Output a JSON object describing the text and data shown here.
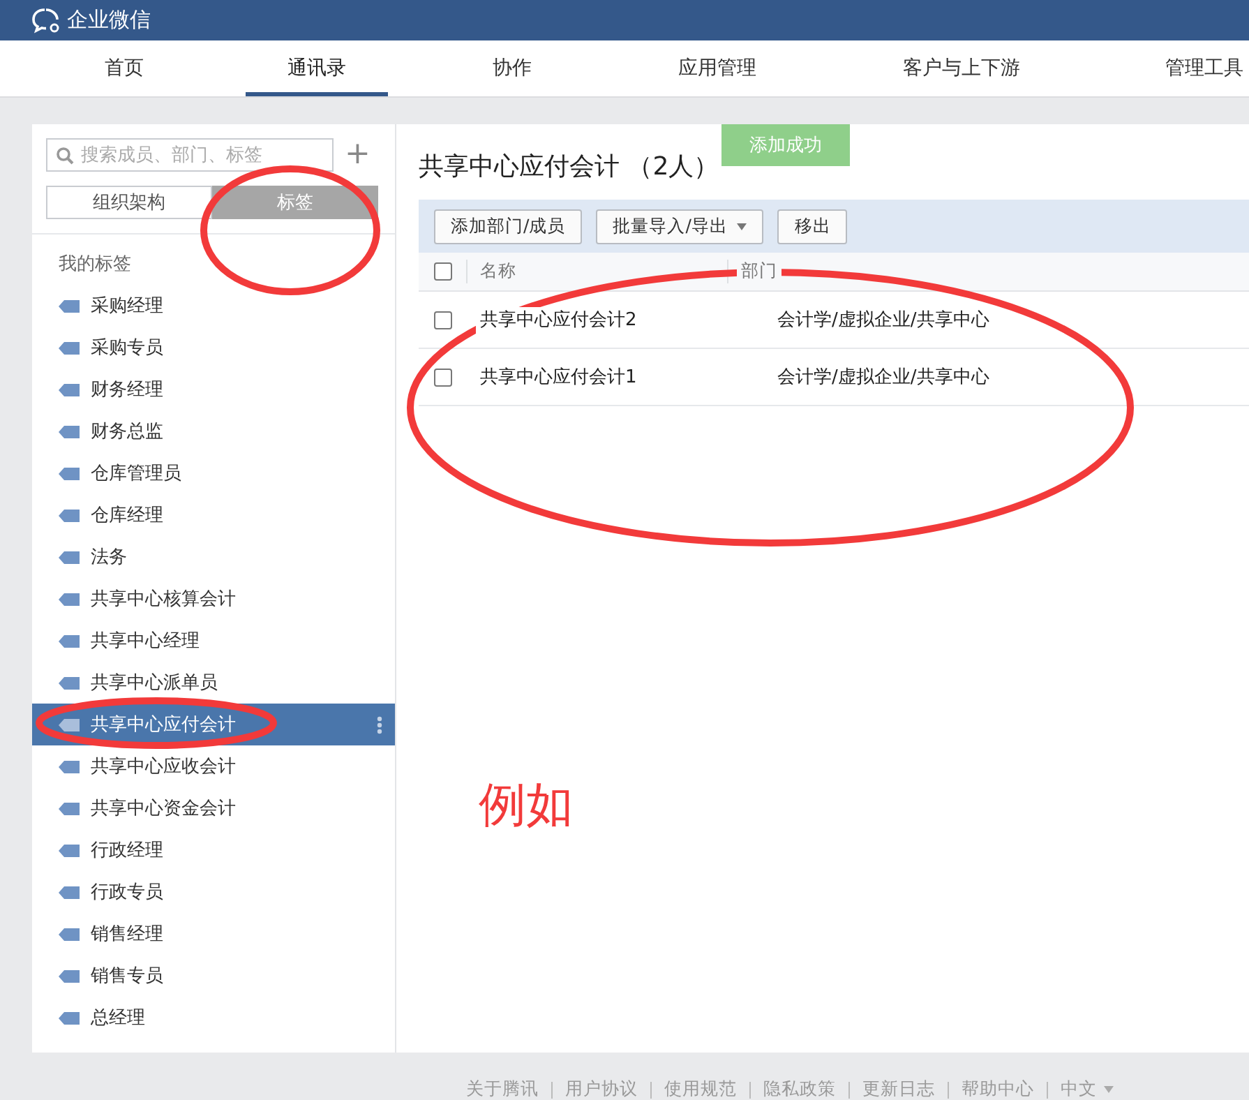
{
  "app": {
    "name": "企业微信"
  },
  "nav": [
    {
      "label": "首页",
      "selected": false
    },
    {
      "label": "通讯录",
      "selected": true
    },
    {
      "label": "协作",
      "selected": false
    },
    {
      "label": "应用管理",
      "selected": false
    },
    {
      "label": "客户与上下游",
      "selected": false
    },
    {
      "label": "管理工具",
      "selected": false
    }
  ],
  "sidebar": {
    "search": {
      "placeholder": "搜索成员、部门、标签"
    },
    "add_button": "+",
    "views": [
      {
        "label": "组织架构",
        "selected": false
      },
      {
        "label": "标签",
        "selected": true
      }
    ],
    "section_title": "我的标签",
    "tags": [
      {
        "label": "采购经理",
        "selected": false
      },
      {
        "label": "采购专员",
        "selected": false
      },
      {
        "label": "财务经理",
        "selected": false
      },
      {
        "label": "财务总监",
        "selected": false
      },
      {
        "label": "仓库管理员",
        "selected": false
      },
      {
        "label": "仓库经理",
        "selected": false
      },
      {
        "label": "法务",
        "selected": false
      },
      {
        "label": "共享中心核算会计",
        "selected": false
      },
      {
        "label": "共享中心经理",
        "selected": false
      },
      {
        "label": "共享中心派单员",
        "selected": false
      },
      {
        "label": "共享中心应付会计",
        "selected": true
      },
      {
        "label": "共享中心应收会计",
        "selected": false
      },
      {
        "label": "共享中心资金会计",
        "selected": false
      },
      {
        "label": "行政经理",
        "selected": false
      },
      {
        "label": "行政专员",
        "selected": false
      },
      {
        "label": "销售经理",
        "selected": false
      },
      {
        "label": "销售专员",
        "selected": false
      },
      {
        "label": "总经理",
        "selected": false
      }
    ]
  },
  "main": {
    "title": "共享中心应付会计 （2人）",
    "toast": "添加成功",
    "toolbar": [
      {
        "label": "添加部门/成员",
        "kind": "button"
      },
      {
        "label": "批量导入/导出",
        "kind": "dropdown"
      },
      {
        "label": "移出",
        "kind": "button"
      }
    ],
    "table": {
      "select_all": {
        "checked": false
      },
      "columns": [
        "名称",
        "部门"
      ],
      "rows": [
        {
          "name": "共享中心应付会计2",
          "department": "会计学/虚拟企业/共享中心",
          "checked": false
        },
        {
          "name": "共享中心应付会计1",
          "department": "会计学/虚拟企业/共享中心",
          "checked": false
        }
      ]
    }
  },
  "footer": {
    "links": [
      "关于腾讯",
      "用户协议",
      "使用规范",
      "隐私政策",
      "更新日志",
      "帮助中心"
    ],
    "language": "中文"
  },
  "annotation": {
    "note": "例如"
  }
}
